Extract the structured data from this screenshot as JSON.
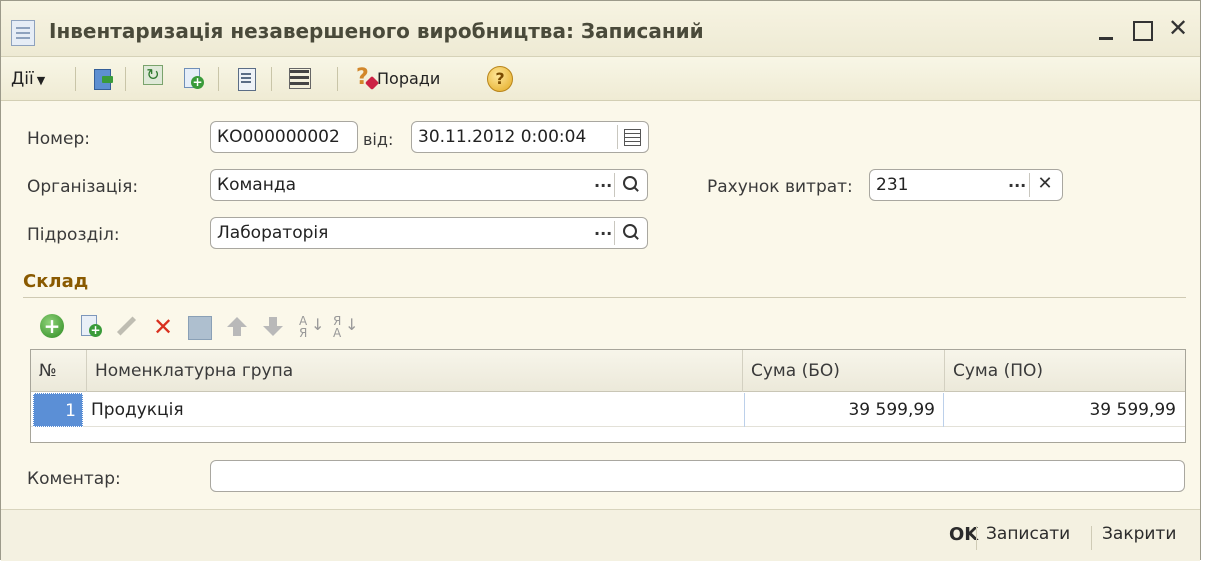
{
  "window": {
    "title": "Інвентаризація незавершеного виробництва: Записаний"
  },
  "toolbar": {
    "actions_label": "Дії",
    "icons": [
      "move-icon",
      "refresh-icon",
      "copy-icon",
      "document-icon",
      "list-icon",
      "tips-icon",
      "help-icon"
    ],
    "tips_label": "Поради",
    "help_label": "?"
  },
  "form": {
    "number_label": "Номер:",
    "number_value": "КО000000002",
    "date_label": "від:",
    "date_value": "30.11.2012  0:00:04",
    "organization_label": "Організація:",
    "organization_value": "Команда",
    "division_label": "Підрозділ:",
    "division_value": "Лабораторія",
    "cost_account_label": "Рахунок витрат:",
    "cost_account_value": "231",
    "comment_label": "Коментар:",
    "comment_value": ""
  },
  "section": {
    "title": "Склад"
  },
  "table": {
    "columns": [
      "№",
      "Номенклатурна група",
      "Сума (БО)",
      "Сума (ПО)"
    ],
    "rows": [
      {
        "num": "1",
        "group": "Продукція",
        "sum_bo": "39 599,99",
        "sum_po": "39 599,99"
      }
    ]
  },
  "footer": {
    "ok_label": "OK",
    "save_label": "Записати",
    "close_label": "Закрити"
  },
  "colors": {
    "window_bg": "#fbf8ea",
    "section_title": "#8a5a00",
    "selected_cell": "#5b8fd6",
    "delete_red": "#d9301e"
  }
}
